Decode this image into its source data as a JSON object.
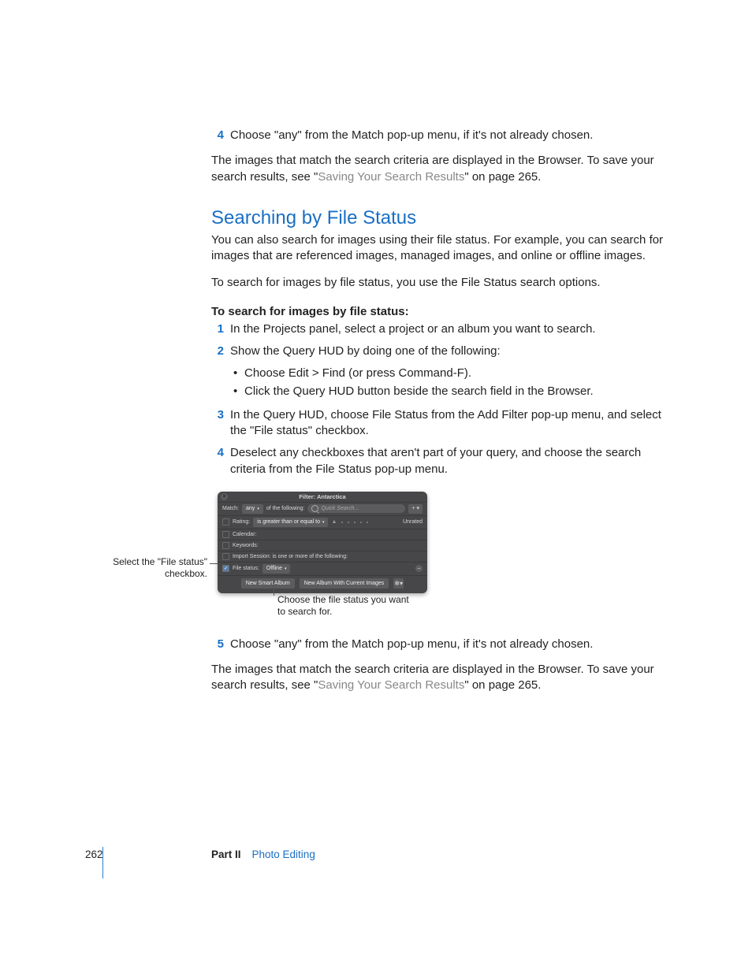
{
  "sec1": {
    "step4_num": "4",
    "step4_text": "Choose \"any\" from the Match pop-up menu, if it's not already chosen.",
    "result_a": "The images that match the search criteria are displayed in the Browser. To save your search results, see \"",
    "result_link": "Saving Your Search Results",
    "result_b": "\" on page 265."
  },
  "heading": "Searching by File Status",
  "intro1": "You can also search for images using their file status. For example, you can search for images that are referenced images, managed images, and online or offline images.",
  "intro2": "To search for images by file status, you use the File Status search options.",
  "sub": "To search for images by file status:",
  "steps": {
    "s1n": "1",
    "s1": "In the Projects panel, select a project or an album you want to search.",
    "s2n": "2",
    "s2": "Show the Query HUD by doing one of the following:",
    "b1": "Choose Edit > Find (or press Command-F).",
    "b2": "Click the Query HUD button beside the search field in the Browser.",
    "s3n": "3",
    "s3": "In the Query HUD, choose File Status from the Add Filter pop-up menu, and select the \"File status\" checkbox.",
    "s4n": "4",
    "s4": "Deselect any checkboxes that aren't part of your query, and choose the search criteria from the File Status pop-up menu."
  },
  "hud": {
    "title": "Filter: Antarctica",
    "match": "Match:",
    "any": "any",
    "of": "of the following:",
    "search_ph": "Quick Search...",
    "add": "+",
    "rating_lbl": "Rating:",
    "rating_val": "is greater than or equal to",
    "unrated": "Unrated",
    "calendar": "Calendar:",
    "keywords": "Keywords:",
    "import": "Import Session: is one or more of the following:",
    "file_status": "File status:",
    "offline": "Offline",
    "btn_smart": "New Smart Album",
    "btn_album": "New Album With Current Images"
  },
  "callouts": {
    "left": "Select the \"File status\" checkbox.",
    "bottom": "Choose the file status you want to search for."
  },
  "sec2": {
    "step5_num": "5",
    "step5_text": "Choose \"any\" from the Match pop-up menu, if it's not already chosen.",
    "result_a": "The images that match the search criteria are displayed in the Browser. To save your search results, see \"",
    "result_link": "Saving Your Search Results",
    "result_b": "\" on page 265."
  },
  "footer": {
    "page": "262",
    "part": "Part II",
    "section": "Photo Editing"
  }
}
